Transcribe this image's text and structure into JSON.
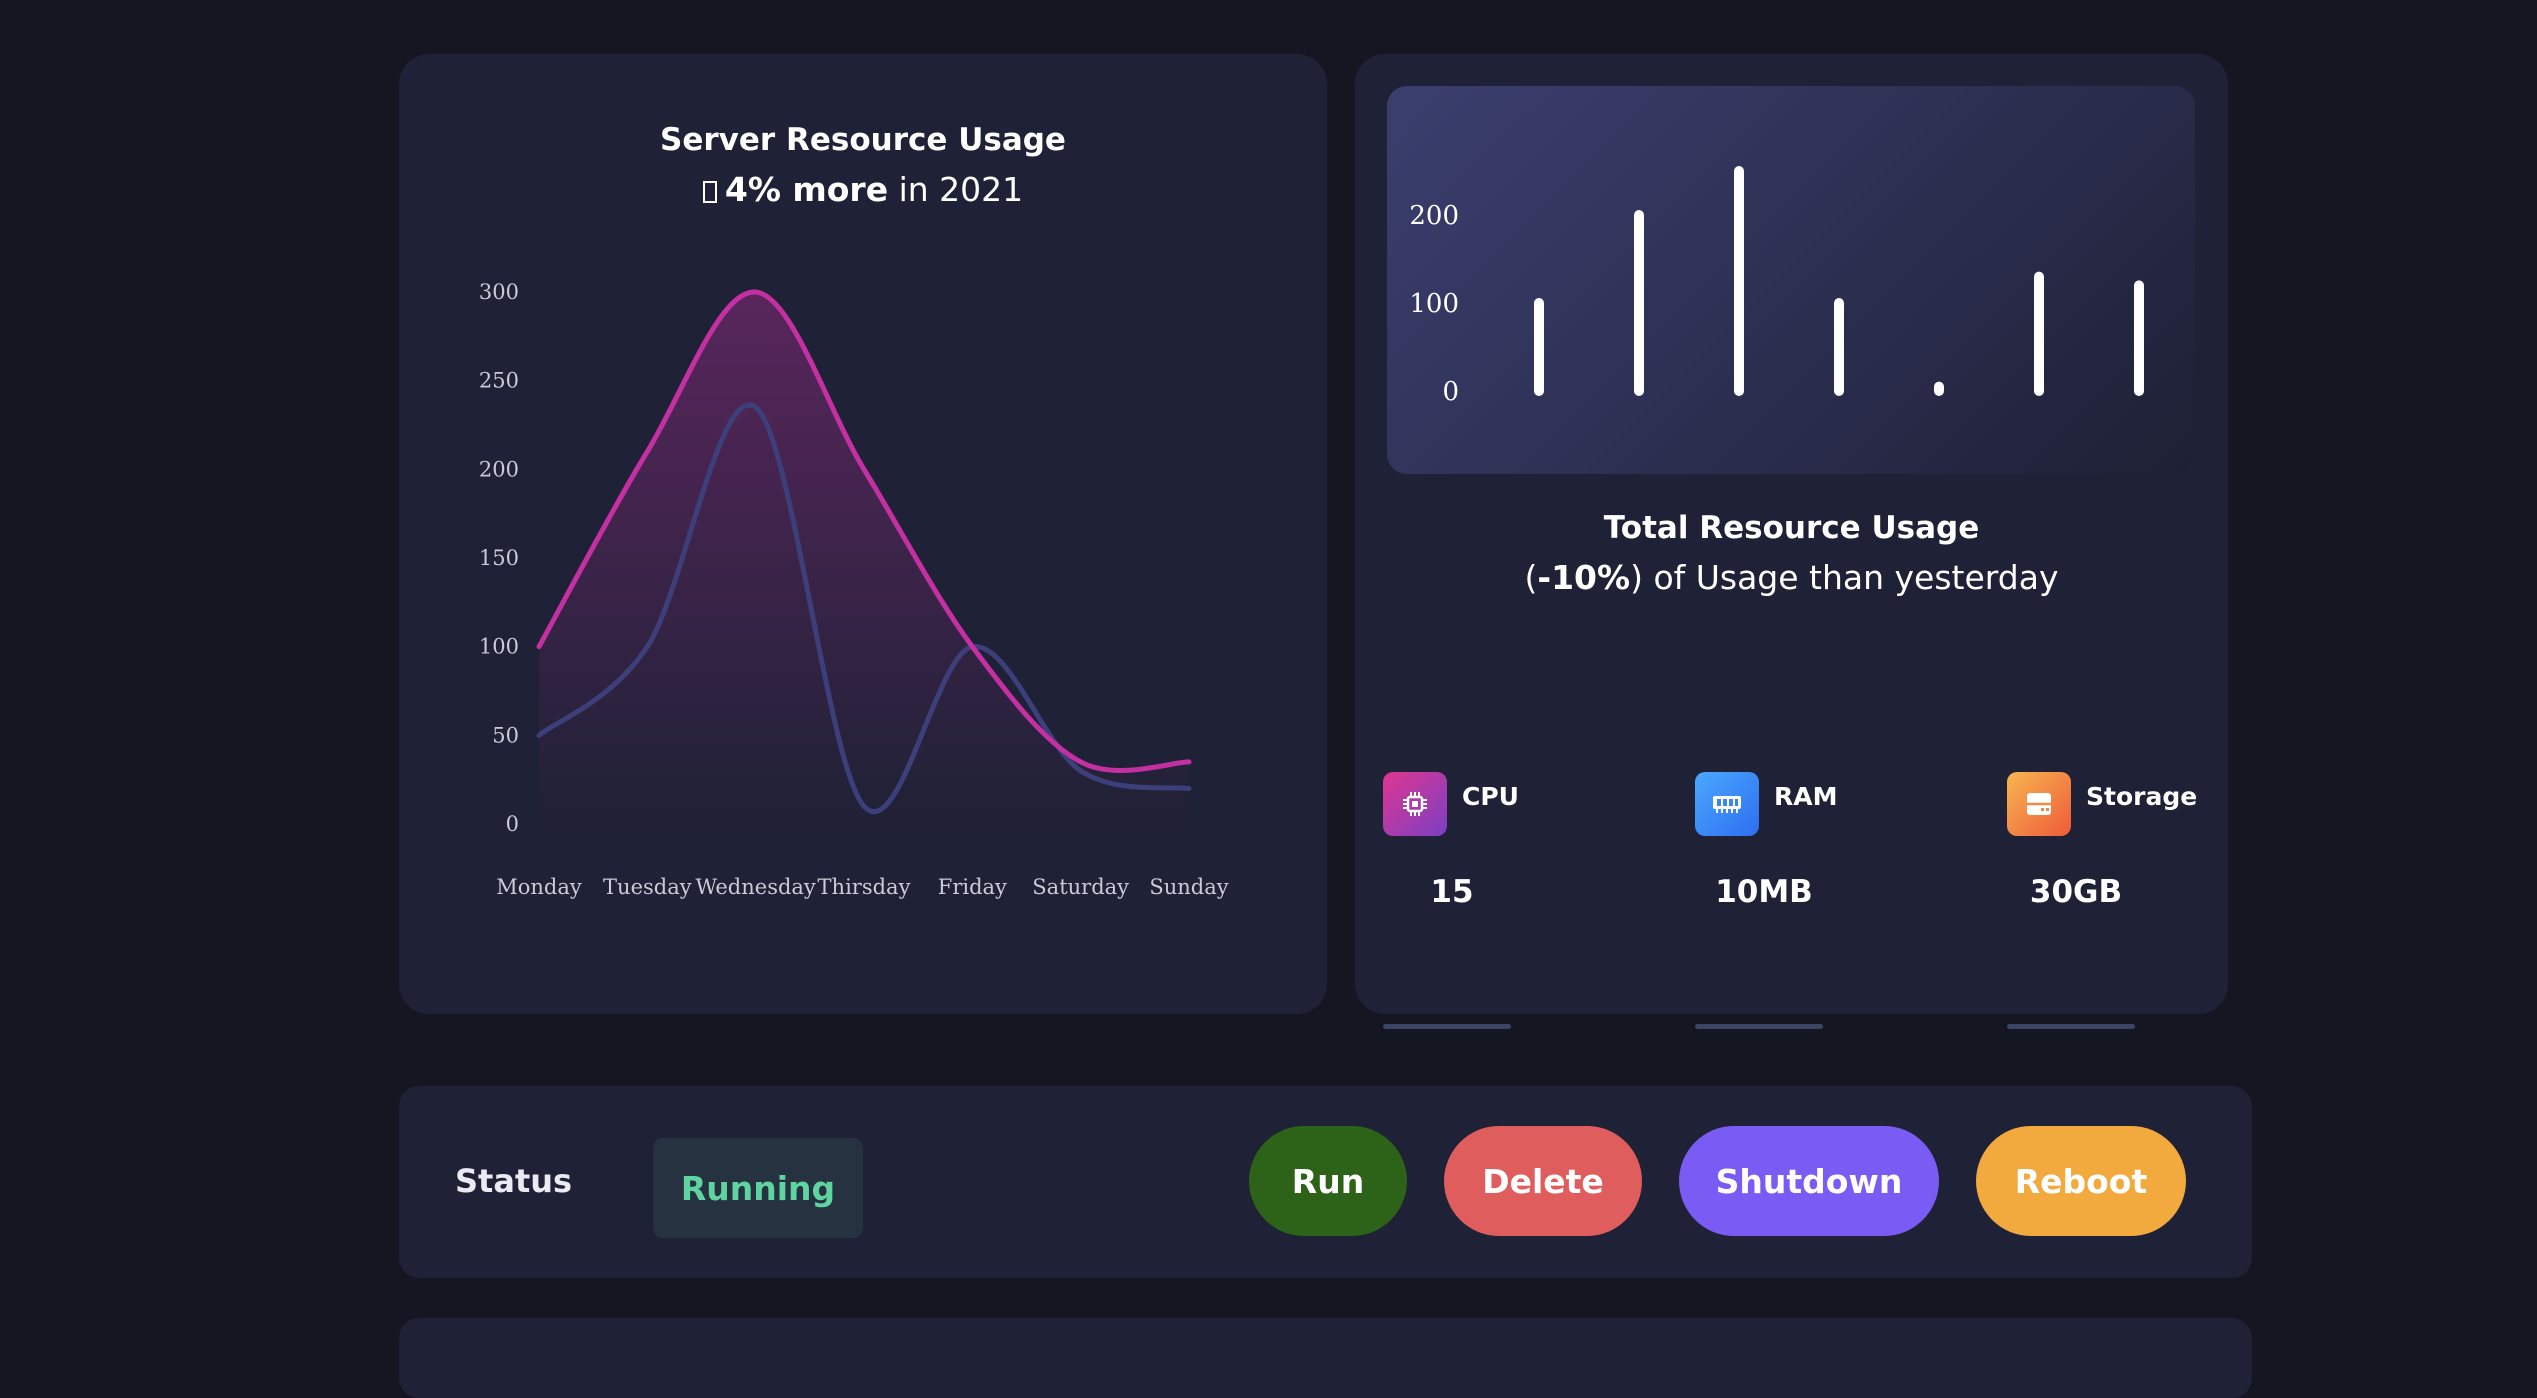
{
  "usage_card": {
    "title": "Server Resource Usage",
    "subtitle_icon": "missing-glyph-icon",
    "subtitle_bold": "4% more",
    "subtitle_rest": " in 2021"
  },
  "total_card": {
    "title": "Total Resource Usage",
    "subtitle_open": "(",
    "subtitle_bold": "-10%",
    "subtitle_rest": ") of Usage than yesterday"
  },
  "stats": [
    {
      "label": "CPU",
      "value": "15",
      "icon": "cpu-chip-icon",
      "color_from": "#e0368f",
      "color_to": "#7a3fc4"
    },
    {
      "label": "RAM",
      "value": "10MB",
      "icon": "memory-module-icon",
      "color_from": "#4aa8ff",
      "color_to": "#2e6ef0"
    },
    {
      "label": "Storage",
      "value": "30GB",
      "icon": "storage-drive-icon",
      "color_from": "#f7b650",
      "color_to": "#ef5a3a"
    }
  ],
  "status": {
    "label": "Status",
    "value": "Running",
    "value_color": "#5fd4a0"
  },
  "actions": [
    {
      "label": "Run",
      "color": "#2d6318"
    },
    {
      "label": "Delete",
      "color": "#e05d5d"
    },
    {
      "label": "Shutdown",
      "color": "#7a5cf5"
    },
    {
      "label": "Reboot",
      "color": "#f2aa3e"
    }
  ],
  "chart_data": [
    {
      "type": "line",
      "title": "Server Resource Usage",
      "categories": [
        "Monday",
        "Tuesday",
        "Wednesday",
        "Thirsday",
        "Friday",
        "Saturday",
        "Sunday"
      ],
      "series": [
        {
          "values": [
            100,
            210,
            300,
            200,
            100,
            35,
            35
          ],
          "color": "#c42fa2",
          "fill": true
        },
        {
          "values": [
            50,
            100,
            235,
            10,
            100,
            30,
            20
          ],
          "color": "#3d3f7a",
          "fill": false
        }
      ],
      "ylim": [
        0,
        300
      ],
      "yticks": [
        0,
        50,
        100,
        150,
        200,
        250,
        300
      ],
      "grid": false,
      "legend": "none"
    },
    {
      "type": "bar",
      "values": [
        100,
        200,
        250,
        100,
        5,
        130,
        120
      ],
      "ylim": [
        0,
        250
      ],
      "yticks": [
        0,
        100,
        200
      ],
      "bar_color": "#ffffff",
      "grid": false,
      "legend": "none"
    }
  ]
}
